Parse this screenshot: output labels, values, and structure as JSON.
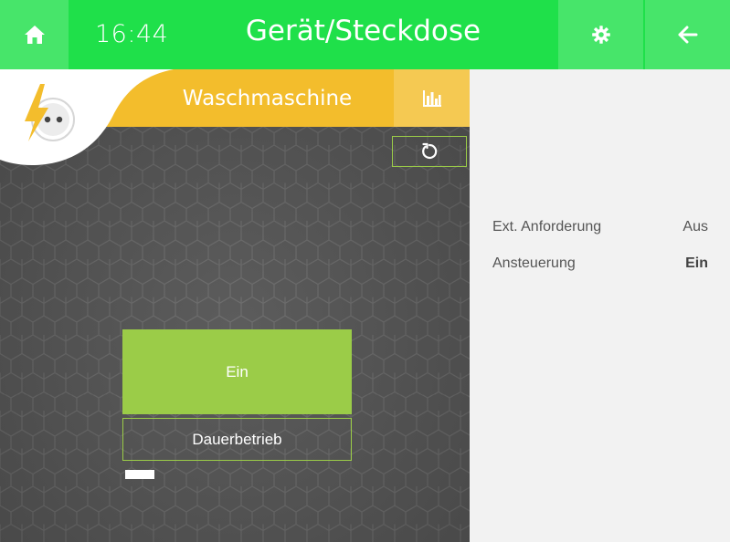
{
  "header": {
    "time": "16:44",
    "title": "Gerät/Steckdose",
    "icons": {
      "home": "home-icon",
      "settings": "gear-icon",
      "back": "arrow-left-icon"
    },
    "accent_color": "#1fe04a"
  },
  "device": {
    "name": "Waschmaschine",
    "icons": {
      "logo": "lightning-plug-icon",
      "chart": "bar-chart-icon",
      "reset": "refresh-icon"
    },
    "header_color": "#f3bd2c",
    "buttons": {
      "on_label": "Ein",
      "continuous_label": "Dauerbetrieb"
    },
    "button_color": "#9bcc48"
  },
  "status": {
    "rows": [
      {
        "label": "Ext. Anforderung",
        "value": "Aus"
      },
      {
        "label": "Ansteuerung",
        "value": "Ein"
      }
    ]
  }
}
